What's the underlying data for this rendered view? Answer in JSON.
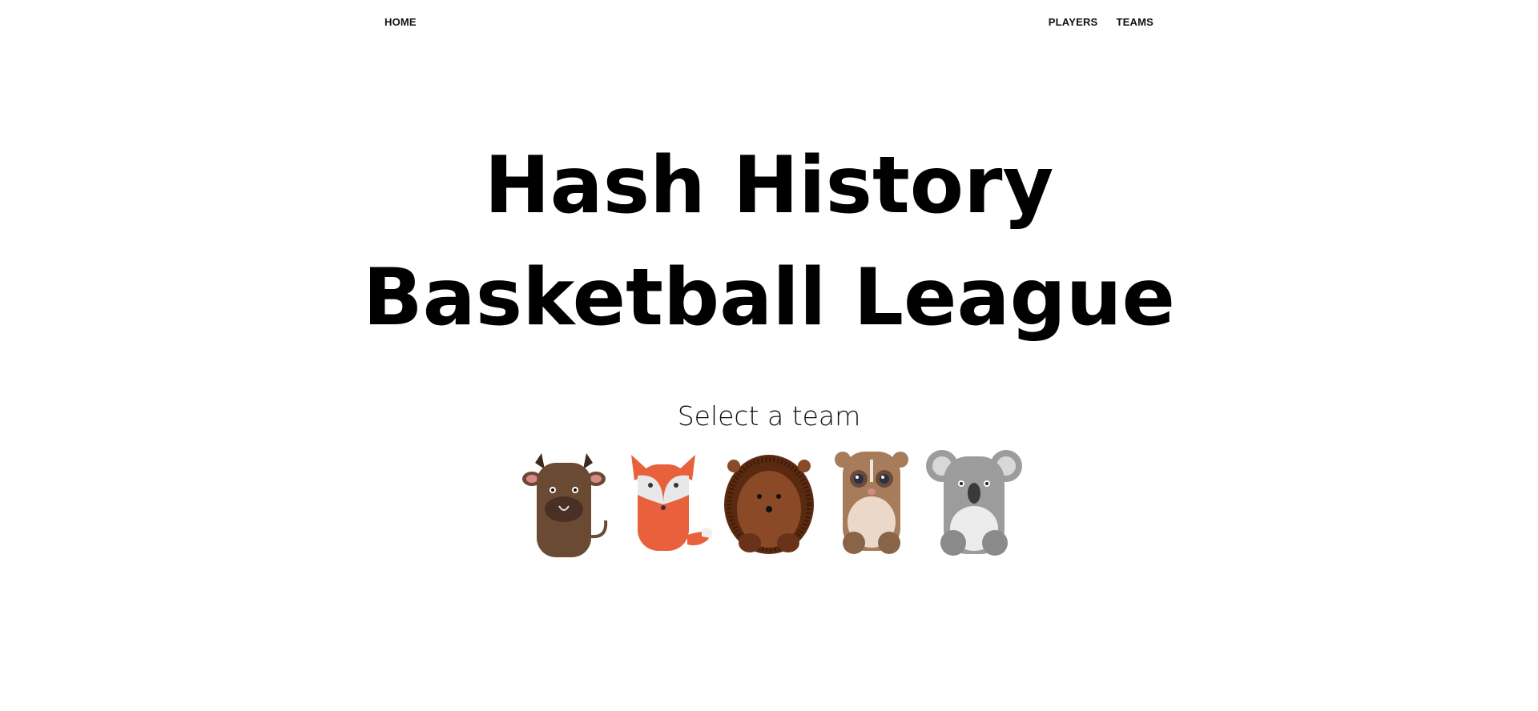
{
  "nav": {
    "home": "HOME",
    "players": "PLAYERS",
    "teams": "TEAMS"
  },
  "hero": {
    "title_line1": "Hash History",
    "title_line2": "Basketball League"
  },
  "select_prompt": "Select a team",
  "teams": [
    {
      "icon": "bull-icon",
      "color": "#6b4a33"
    },
    {
      "icon": "fox-icon",
      "color": "#e8603c"
    },
    {
      "icon": "hedgehog-icon",
      "color": "#7a3c1c"
    },
    {
      "icon": "lemur-icon",
      "color": "#a67c5b"
    },
    {
      "icon": "koala-icon",
      "color": "#8c8c8c"
    }
  ]
}
